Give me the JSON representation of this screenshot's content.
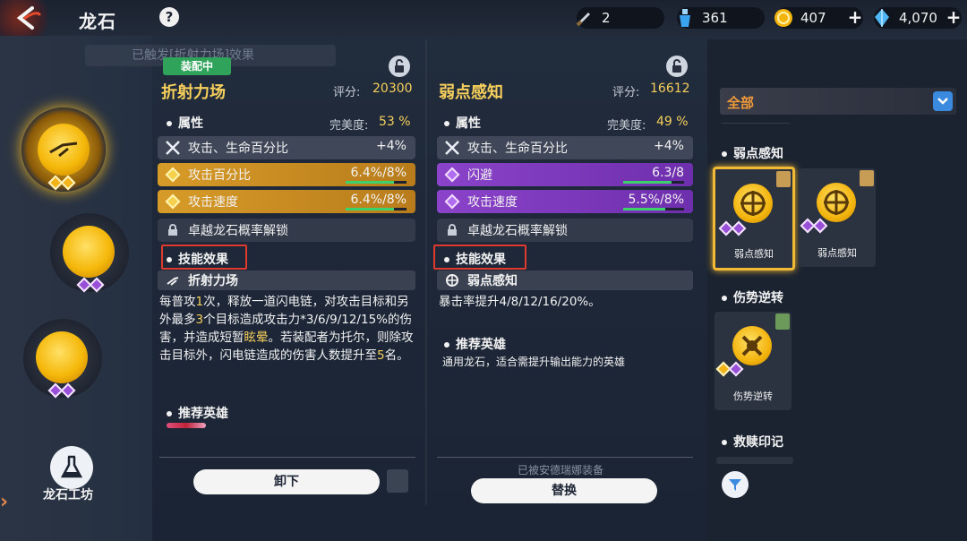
{
  "header": {
    "title": "龙石",
    "help": "?",
    "resources": [
      {
        "icon": "sword-icon",
        "value": "2"
      },
      {
        "icon": "potion-icon",
        "value": "361"
      },
      {
        "icon": "gold-coin-icon",
        "value": "407"
      },
      {
        "icon": "crystal-icon",
        "value": "4,070"
      }
    ]
  },
  "breadcrumb": "已触发[折射力场]效果",
  "sidebar": {
    "workshop_label": "龙石工坊"
  },
  "panel_left": {
    "equipped_badge": "装配中",
    "name": "折射力场",
    "score_label": "评分:",
    "score": "20300",
    "attributes_title": "属性",
    "completeness_label": "完美度:",
    "completeness": "53 %",
    "rows": [
      {
        "label": "攻击、生命百分比",
        "value": "+4%",
        "kind": "base"
      },
      {
        "label": "攻击百分比",
        "value": "6.4%/8%",
        "kind": "gold",
        "progress": 0.8
      },
      {
        "label": "攻击速度",
        "value": "6.4%/8%",
        "kind": "gold",
        "progress": 0.8
      },
      {
        "label": "卓越龙石概率解锁",
        "value": "",
        "kind": "locked"
      }
    ],
    "skill_title": "技能效果",
    "skill_name": "折射力场",
    "skill_desc_parts": [
      "每普攻",
      "1",
      "次，释放一道闪电链，对攻击目标和另外最多",
      "3",
      "个目标造成攻击力*3/6/9/12/15%的伤害，并造成短暂",
      "眩晕",
      "。若装配者为托尔，则除攻击目标外，闪电链造成的伤害人数提升至",
      "5",
      "名。"
    ],
    "recommend_title": "推荐英雄",
    "button": "卸下"
  },
  "panel_right": {
    "name": "弱点感知",
    "score_label": "评分:",
    "score": "16612",
    "attributes_title": "属性",
    "completeness_label": "完美度:",
    "completeness": "49 %",
    "rows": [
      {
        "label": "攻击、生命百分比",
        "value": "+4%",
        "kind": "base"
      },
      {
        "label": "闪避",
        "value": "6.3/8",
        "kind": "purple",
        "progress": 0.79
      },
      {
        "label": "攻击速度",
        "value": "5.5%/8%",
        "kind": "purple",
        "progress": 0.69
      },
      {
        "label": "卓越龙石概率解锁",
        "value": "",
        "kind": "locked"
      }
    ],
    "skill_title": "技能效果",
    "skill_name": "弱点感知",
    "skill_desc": "暴击率提升4/8/12/16/20%。",
    "recommend_title": "推荐英雄",
    "recommend_desc": "通用龙石，适合需提升输出能力的英雄",
    "equipped_by": "已被安德瑞娜装备",
    "button": "替换"
  },
  "inventory": {
    "filter_label": "全部",
    "groups": [
      {
        "title": "弱点感知",
        "items": [
          "弱点感知",
          "弱点感知"
        ]
      },
      {
        "title": "伤势逆转",
        "items": [
          "伤势逆转"
        ]
      },
      {
        "title": "救赎印记",
        "items": []
      }
    ]
  },
  "colors": {
    "accent_gold": "#f6cf5c",
    "stat_gold": "#d79b28",
    "stat_purple": "#8a43c9",
    "equip_green": "#2fa35a",
    "highlight_red": "#e03a2f",
    "filter_orange": "#f09a3a"
  }
}
